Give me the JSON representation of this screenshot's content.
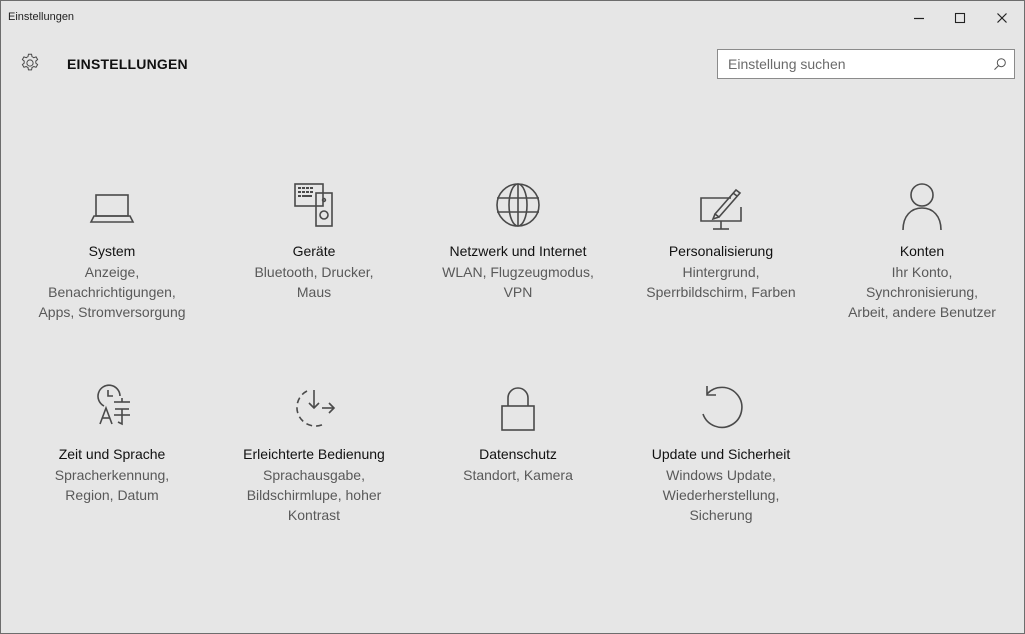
{
  "window": {
    "title": "Einstellungen"
  },
  "header": {
    "title": "EINSTELLUNGEN",
    "search_placeholder": "Einstellung suchen"
  },
  "tiles": [
    {
      "name": "System",
      "desc_lines": [
        "Anzeige,",
        "Benachrichtigungen,",
        "Apps, Stromversorgung"
      ],
      "icon": "laptop-icon"
    },
    {
      "name": "Geräte",
      "desc_lines": [
        "Bluetooth, Drucker,",
        "Maus"
      ],
      "icon": "devices-icon"
    },
    {
      "name": "Netzwerk und Internet",
      "desc_lines": [
        "WLAN, Flugzeugmodus,",
        "VPN"
      ],
      "icon": "globe-icon"
    },
    {
      "name": "Personalisierung",
      "desc_lines": [
        "Hintergrund,",
        "Sperrbildschirm, Farben"
      ],
      "icon": "paint-screen-icon"
    },
    {
      "name": "Konten",
      "desc_lines": [
        "Ihr Konto,",
        "Synchronisierung,",
        "Arbeit, andere Benutzer"
      ],
      "icon": "person-icon"
    },
    {
      "name": "Zeit und Sprache",
      "desc_lines": [
        "Spracherkennung,",
        "Region, Datum"
      ],
      "icon": "clock-language-icon"
    },
    {
      "name": "Erleichterte Bedienung",
      "desc_lines": [
        "Sprachausgabe,",
        "Bildschirmlupe, hoher",
        "Kontrast"
      ],
      "icon": "ease-of-access-icon"
    },
    {
      "name": "Datenschutz",
      "desc_lines": [
        "Standort, Kamera"
      ],
      "icon": "lock-icon"
    },
    {
      "name": "Update und Sicherheit",
      "desc_lines": [
        "Windows Update,",
        "Wiederherstellung,",
        "Sicherung"
      ],
      "icon": "refresh-icon"
    }
  ],
  "colors": {
    "background": "#e6e6e6",
    "icon_stroke": "#4a4a4a",
    "title_text": "#111111",
    "desc_text": "#595959"
  }
}
